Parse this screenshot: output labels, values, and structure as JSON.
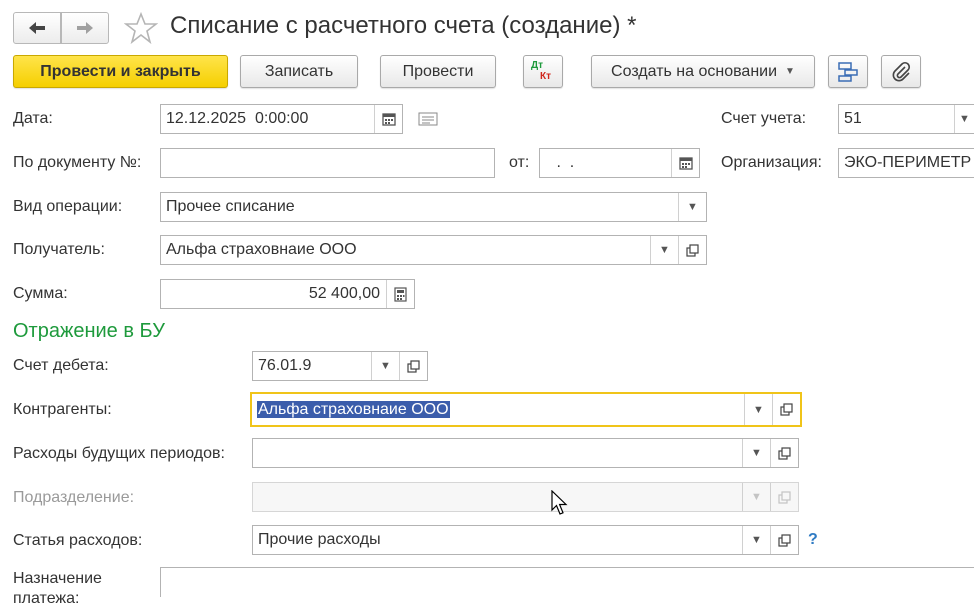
{
  "window": {
    "title": "Списание с расчетного счета (создание) *"
  },
  "toolbar": {
    "post_close_label": "Провести и закрыть",
    "save_label": "Записать",
    "post_label": "Провести",
    "dtkt_top": "Дт",
    "dtkt_bottom": "Кт",
    "create_based_label": "Создать на основании"
  },
  "form": {
    "date_label": "Дата:",
    "date_value": "12.12.2025  0:00:00",
    "account_label": "Счет учета:",
    "account_value": "51",
    "docnum_label": "По документу №:",
    "docnum_value": "",
    "from_label": "от:",
    "from_value": " .  .",
    "org_label": "Организация:",
    "org_value": "ЭКО-ПЕРИМЕТР",
    "optype_label": "Вид операции:",
    "optype_value": "Прочее списание",
    "recipient_label": "Получатель:",
    "recipient_value": "Альфа страховнаие ООО",
    "amount_label": "Сумма:",
    "amount_value": "52 400,00"
  },
  "accounting": {
    "section_title": "Отражение в БУ",
    "debit_label": "Счет дебета:",
    "debit_value": "76.01.9",
    "counterparty_label": "Контрагенты:",
    "counterparty_value": "Альфа страховнаие ООО",
    "deferred_label": "Расходы будущих периодов:",
    "deferred_value": "",
    "division_label": "Подразделение:",
    "division_value": "",
    "expense_label": "Статья расходов:",
    "expense_value": "Прочие расходы",
    "help_mark": "?",
    "purpose_label_1": "Назначение",
    "purpose_label_2": "платежа:"
  },
  "colors": {
    "primary_button": "#f5cf00",
    "section_title": "#1e9a3c",
    "focus_border": "#f0c419",
    "selection": "#3b5dab"
  }
}
